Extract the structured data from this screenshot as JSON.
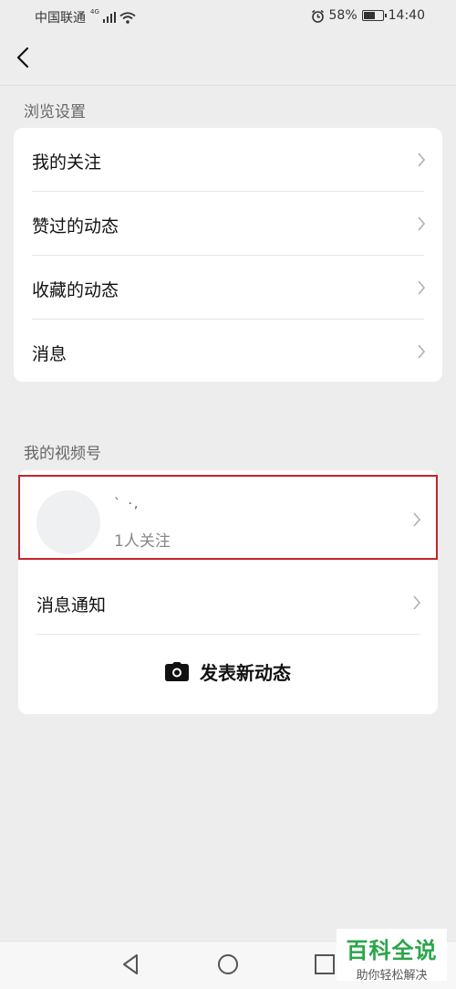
{
  "status_bar": {
    "carrier": "中国联通",
    "network": "4G",
    "battery": "58%",
    "battery_level": 0.58,
    "time": "14:40"
  },
  "header": {
    "back_icon": "chevron-left-icon"
  },
  "browse_settings": {
    "title": "浏览设置",
    "items": [
      {
        "label": "我的关注"
      },
      {
        "label": "赞过的动态"
      },
      {
        "label": "收藏的动态"
      },
      {
        "label": "消息"
      }
    ]
  },
  "my_channels": {
    "title": "我的视频号",
    "profile": {
      "nickname": "` ·,",
      "followers": "1人关注"
    },
    "message_notice": "消息通知",
    "post_button": "发表新动态",
    "post_icon": "camera-icon"
  },
  "nav_bar": {
    "back": "triangle-back-icon",
    "home": "circle-home-icon",
    "recents": "square-recents-icon"
  },
  "watermark": {
    "title": "百科全说",
    "subtitle": "助你轻松解决"
  },
  "colors": {
    "background": "#ededed",
    "highlight_border": "#c4242c",
    "watermark_green": "#2aa54a"
  }
}
